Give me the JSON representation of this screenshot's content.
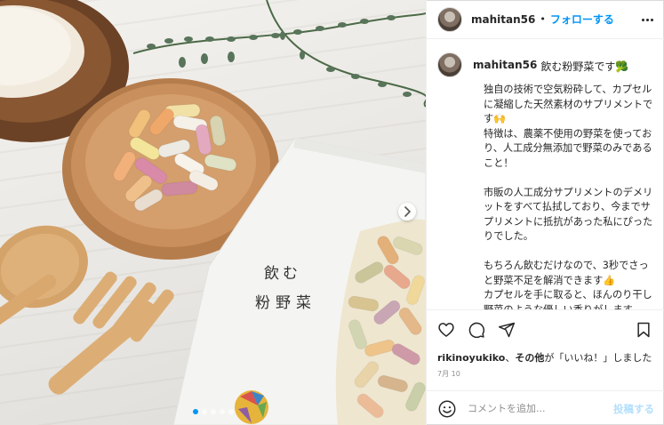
{
  "header": {
    "username": "mahitan56",
    "separator": "•",
    "follow_label": "フォローする"
  },
  "caption": {
    "username": "mahitan56",
    "title": "飲む粉野菜です🥦",
    "body": "独自の技術で空気粉砕して、カプセルに凝縮した天然素材のサプリメントです🙌\n特徴は、農薬不使用の野菜を使っており、人工成分無添加で野菜のみであること！\n\n市販の人工成分サプリメントのデメリットをすべて払拭しており、今までサプリメントに抵抗があった私にぴったりでした。\n\nもちろん飲むだけなので、3秒でさっと野菜不足を解消できます👍\nカプセルを手に取ると、ほんのり干し野菜のような優しい香りがします。\nカプセルは少しだけ大きめ、私は何"
  },
  "product": {
    "label_line1": "飲む",
    "label_line2": "粉野菜"
  },
  "likes": {
    "user": "rikinoyukiko",
    "connector": "、",
    "others": "その他",
    "suffix": "が「いいね！」しました"
  },
  "date": "7月 10",
  "comment": {
    "placeholder": "コメントを追加...",
    "post_label": "投稿する"
  },
  "icons": {
    "like": "heart-icon",
    "comment": "comment-icon",
    "share": "share-icon",
    "save": "bookmark-icon",
    "emoji": "emoji-icon",
    "more": "more-icon",
    "next": "chevron-right-icon"
  },
  "colors": {
    "accent": "#0095f6",
    "text": "#262626",
    "muted": "#8e8e8e",
    "post_disabled": "#b2dffc"
  },
  "carousel": {
    "current": 1,
    "total": 5
  }
}
